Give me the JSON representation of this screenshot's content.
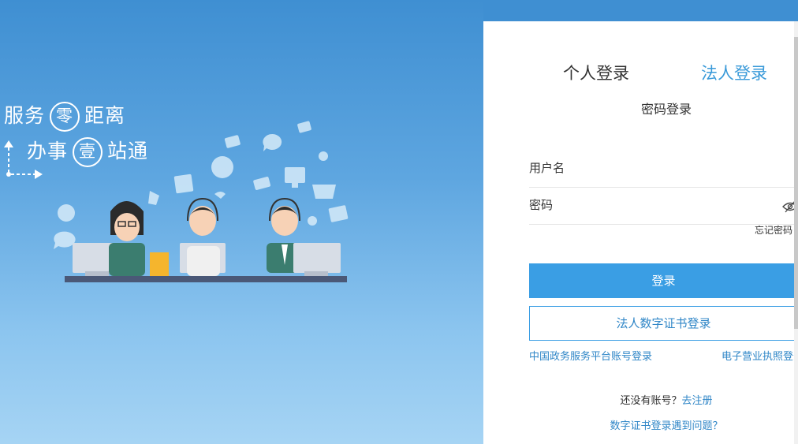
{
  "slogan": {
    "line1_a": "服务",
    "line1_circle": "零",
    "line1_b": "距离",
    "line2_a": "办事",
    "line2_circle": "壹",
    "line2_b": "站通"
  },
  "login": {
    "tabs": {
      "personal": "个人登录",
      "legal": "法人登录"
    },
    "subtitle": "密码登录",
    "username_placeholder": "用户名",
    "password_placeholder": "密码",
    "forgot": "忘记密码",
    "login_button": "登录",
    "cert_button": "法人数字证书登录",
    "gov_link": "中国政务服务平台账号登录",
    "biz_link": "电子营业执照登录",
    "no_account": "还没有账号？",
    "register": "去注册",
    "cert_problem": "数字证书登录遇到问题？"
  },
  "colors": {
    "accent": "#3a9ee4",
    "link": "#2f86c7",
    "bg_top": "#3f8fd2",
    "bg_bottom": "#a6d4f4"
  },
  "icons": [
    "eye-slash-icon",
    "customer-service-illustration"
  ]
}
